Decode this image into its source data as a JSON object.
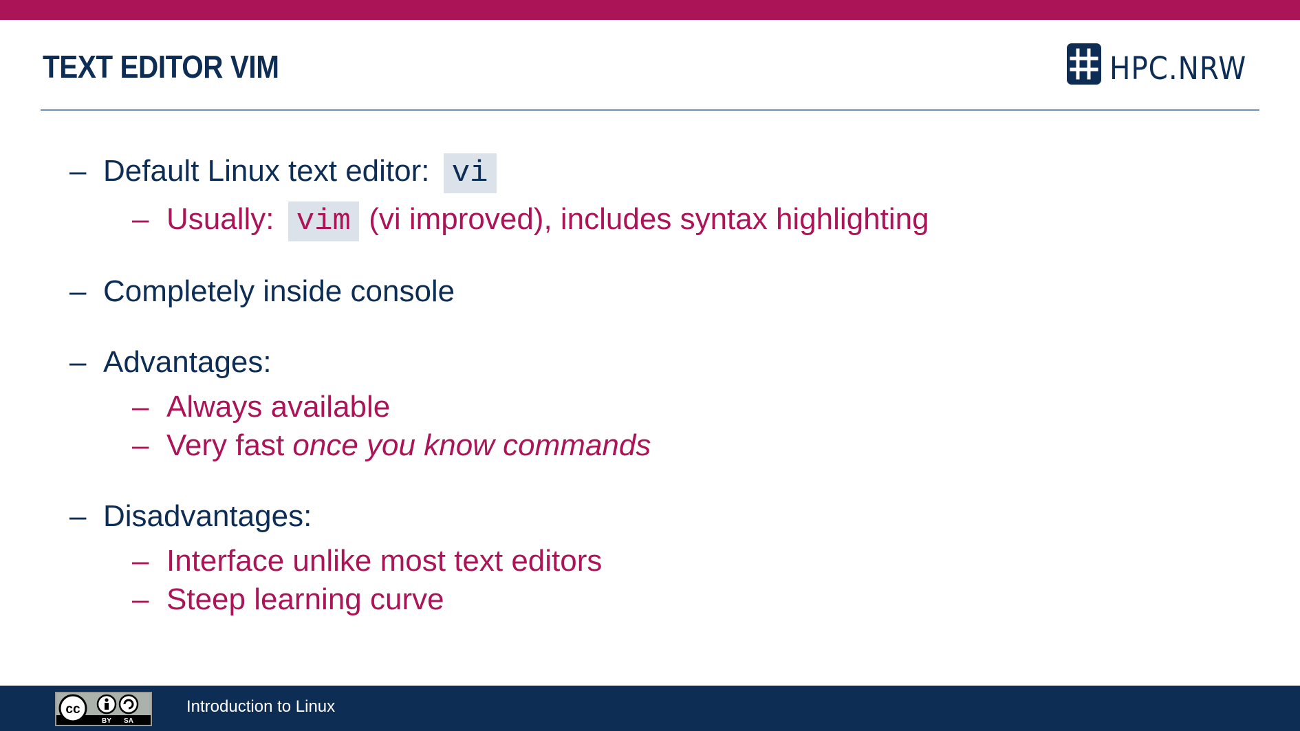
{
  "header": {
    "title": "TEXT EDITOR VIM",
    "logo_text": "HPC.NRW",
    "logo_icon": "hash-icon",
    "accent_color": "#ab1558",
    "navy_color": "#0d2d55"
  },
  "bullets": {
    "dash": "–",
    "b1": {
      "text": "Default Linux text editor:",
      "code": "vi"
    },
    "b1_1": {
      "prefix": "Usually:",
      "code": "vim",
      "suffix": "(vi improved), includes syntax highlighting"
    },
    "b2": {
      "text": "Completely inside console"
    },
    "b3": {
      "text": "Advantages:"
    },
    "b3_1": {
      "text": "Always available"
    },
    "b3_2": {
      "prefix": "Very fast",
      "italic": "once you know commands"
    },
    "b4": {
      "text": "Disadvantages:"
    },
    "b4_1": {
      "text": "Interface unlike most text editors"
    },
    "b4_2": {
      "text": "Steep learning curve"
    }
  },
  "footer": {
    "title": "Introduction to Linux",
    "license_by": "BY",
    "license_sa": "SA",
    "license_icon": "creative-commons-icon"
  }
}
